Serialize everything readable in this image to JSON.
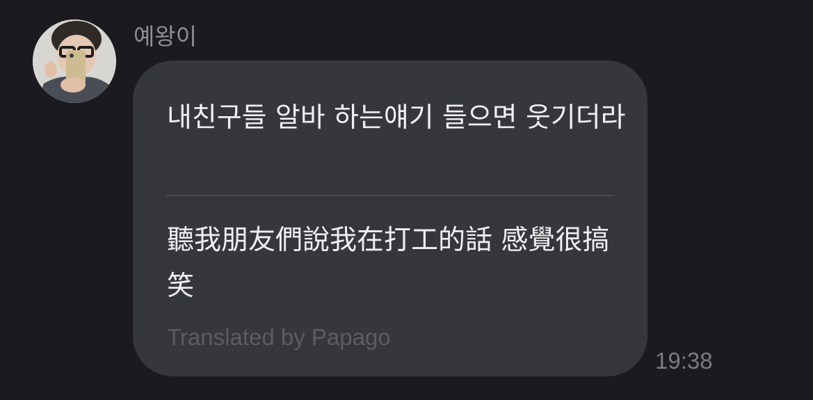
{
  "message": {
    "sender_name": "예왕이",
    "avatar_icon": "user-avatar-photo",
    "original_text": "내친구들 알바 하는얘기 들으면 웃기더라",
    "translated_text": "聽我朋友們說我在打工的話 感覺很搞笑",
    "translator_credit": "Translated by Papago",
    "timestamp": "19:38"
  },
  "colors": {
    "background": "#1b1b1f",
    "bubble": "#36373c",
    "text": "#f0f0f2",
    "muted_text": "#8e8e94"
  }
}
